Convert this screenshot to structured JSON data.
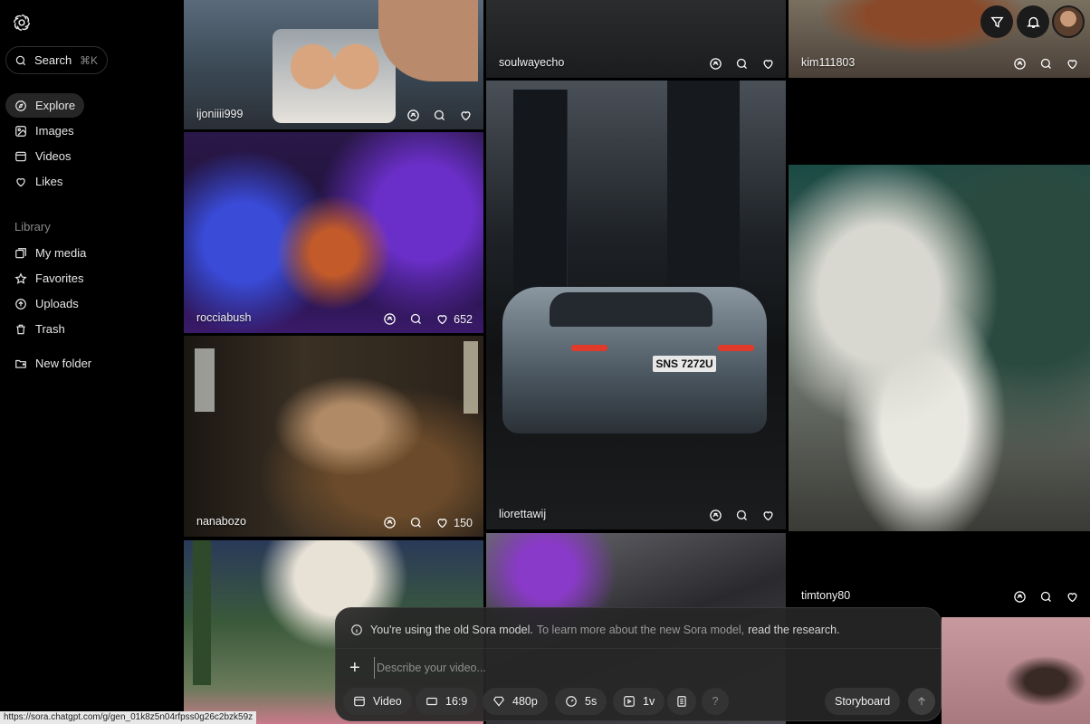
{
  "sidebar": {
    "search_label": "Search",
    "search_shortcut": "⌘K",
    "nav": [
      {
        "label": "Explore",
        "icon": "compass-icon"
      },
      {
        "label": "Images",
        "icon": "image-icon"
      },
      {
        "label": "Videos",
        "icon": "video-icon"
      },
      {
        "label": "Likes",
        "icon": "heart-icon"
      }
    ],
    "library_label": "Library",
    "library": [
      {
        "label": "My media",
        "icon": "media-icon"
      },
      {
        "label": "Favorites",
        "icon": "star-icon"
      },
      {
        "label": "Uploads",
        "icon": "upload-icon"
      },
      {
        "label": "Trash",
        "icon": "trash-icon"
      }
    ],
    "new_folder_label": "New folder"
  },
  "feed": {
    "tiles": [
      {
        "user": "ijoniiii999",
        "likes": ""
      },
      {
        "user": "rocciabush",
        "likes": "652"
      },
      {
        "user": "nanabozo",
        "likes": "150"
      },
      {
        "user": "soulwayecho",
        "likes": ""
      },
      {
        "user": "liorettawij",
        "likes": ""
      },
      {
        "user": "kim111803",
        "likes": ""
      },
      {
        "user": "timtony80",
        "likes": ""
      }
    ],
    "plate_text": "SNS 7272U"
  },
  "composer": {
    "notice_main": "You're using the old Sora model.",
    "notice_sub": "To learn more about the new Sora model,",
    "notice_link": "read the research.",
    "placeholder": "Describe your video...",
    "chips": {
      "type": "Video",
      "aspect": "16:9",
      "resolution": "480p",
      "duration": "5s",
      "variations": "1v",
      "help": "?",
      "storyboard": "Storyboard"
    }
  },
  "status_url": "https://sora.chatgpt.com/g/gen_01k8z5n04rfpss0g26c2bzk59z"
}
